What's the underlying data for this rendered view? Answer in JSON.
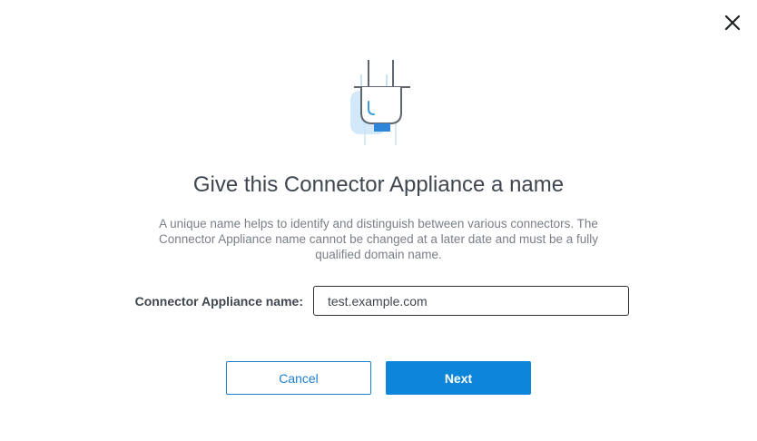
{
  "dialog": {
    "title": "Give this Connector Appliance a name",
    "description": "A unique name helps to identify and distinguish between various connectors. The Connector Appliance name cannot be changed at a later date and must be a fully qualified domain name.",
    "field_label": "Connector Appliance name:",
    "field_value": "test.example.com",
    "cancel_label": "Cancel",
    "next_label": "Next"
  },
  "icons": {
    "close": "close-icon",
    "illustration": "plug-icon"
  },
  "colors": {
    "accent": "#0d85d8",
    "title_text": "#3f4650",
    "body_text": "#7a7f86"
  }
}
